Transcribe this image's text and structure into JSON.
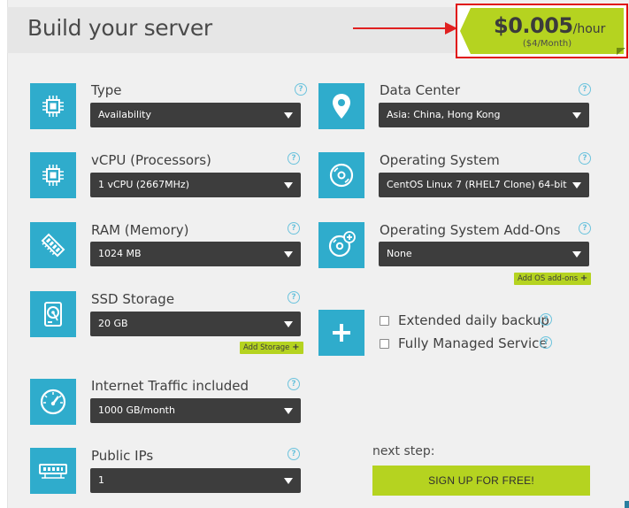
{
  "header": {
    "title": "Build your server"
  },
  "price": {
    "amount": "$0.005",
    "unit": "/hour",
    "monthly": "($4/Month)"
  },
  "fields": {
    "type": {
      "label": "Type",
      "value": "Availability"
    },
    "vcpu": {
      "label": "vCPU (Processors)",
      "value": "1 vCPU (2667MHz)"
    },
    "ram": {
      "label": "RAM (Memory)",
      "value": "1024 MB"
    },
    "ssd": {
      "label": "SSD Storage",
      "value": "20 GB",
      "add_label": "Add Storage"
    },
    "traffic": {
      "label": "Internet Traffic included",
      "value": "1000 GB/month"
    },
    "ips": {
      "label": "Public IPs",
      "value": "1"
    },
    "datacenter": {
      "label": "Data Center",
      "value": "Asia: China, Hong Kong"
    },
    "os": {
      "label": "Operating System",
      "value": "CentOS Linux 7 (RHEL7 Clone) 64-bit"
    },
    "os_addons": {
      "label": "Operating System Add-Ons",
      "value": "None",
      "add_label": "Add OS add-ons"
    }
  },
  "extras": {
    "backup_label": "Extended daily backup",
    "managed_label": "Fully Managed Service"
  },
  "next": {
    "label": "next step:",
    "button": "SIGN UP FOR FREE!"
  },
  "help_glyph": "?",
  "plus_glyph": "+",
  "colors": {
    "accent_green": "#b5d320",
    "icon_blue": "#2faccc",
    "select_dark": "#3d3d3d",
    "highlight_red": "#e01010"
  }
}
